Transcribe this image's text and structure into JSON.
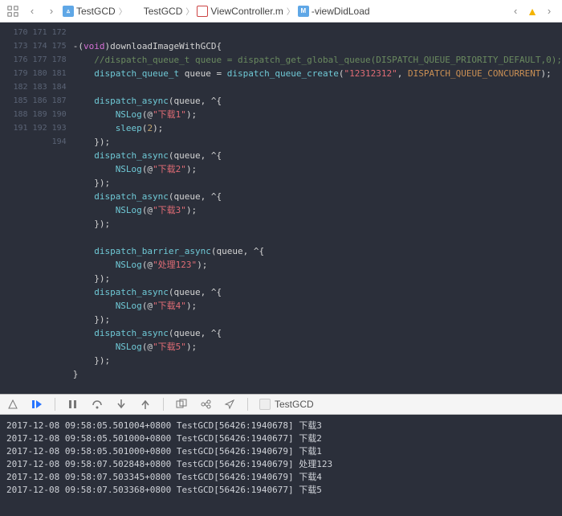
{
  "nav": {
    "crumb1": "TestGCD",
    "crumb2": "TestGCD",
    "crumb3": "ViewController.m",
    "crumb4": "-viewDidLoad"
  },
  "lines": {
    "start": 170,
    "end": 194
  },
  "code": {
    "l170_sig_pre": "-(",
    "l170_void": "void",
    "l170_sig_post": ")",
    "l170_fname": "downloadImageWithGCD",
    "l170_brace": "{",
    "l171_cmt": "//dispatch_queue_t queue = dispatch_get_global_queue(DISPATCH_QUEUE_PRIORITY_DEFAULT,0);",
    "l172_t": "dispatch_queue_t",
    "l172_q": " queue ",
    "l172_eq": "= ",
    "l172_fn": "dispatch_queue_create",
    "l172_p": "(",
    "l172_s": "\"12312312\"",
    "l172_c": ", ",
    "l172_const": "DISPATCH_QUEUE_CONCURRENT",
    "l172_end": ");",
    "async": "dispatch_async",
    "barrier": "dispatch_barrier_async",
    "args": "(queue, ^{",
    "nslog": "NSLog",
    "op_at": "(@",
    "s1": "\"下载1\"",
    "s2": "\"下载2\"",
    "s3": "\"下载3\"",
    "sb": "\"处理123\"",
    "s4": "\"下载4\"",
    "s5": "\"下载5\"",
    "close_log": ");",
    "sleep": "sleep",
    "sleep_arg_open": "(",
    "sleep_num": "2",
    "sleep_arg_close": ");",
    "blk_close": "});",
    "final_brace": "}"
  },
  "debug": {
    "target": "TestGCD"
  },
  "console": {
    "r1": "2017-12-08 09:58:05.501004+0800 TestGCD[56426:1940678] 下载3",
    "r2": "2017-12-08 09:58:05.501000+0800 TestGCD[56426:1940677] 下载2",
    "r3": "2017-12-08 09:58:05.501000+0800 TestGCD[56426:1940679] 下载1",
    "r4": "2017-12-08 09:58:07.502848+0800 TestGCD[56426:1940679] 处理123",
    "r5": "2017-12-08 09:58:07.503345+0800 TestGCD[56426:1940679] 下载4",
    "r6": "2017-12-08 09:58:07.503368+0800 TestGCD[56426:1940677] 下载5"
  }
}
